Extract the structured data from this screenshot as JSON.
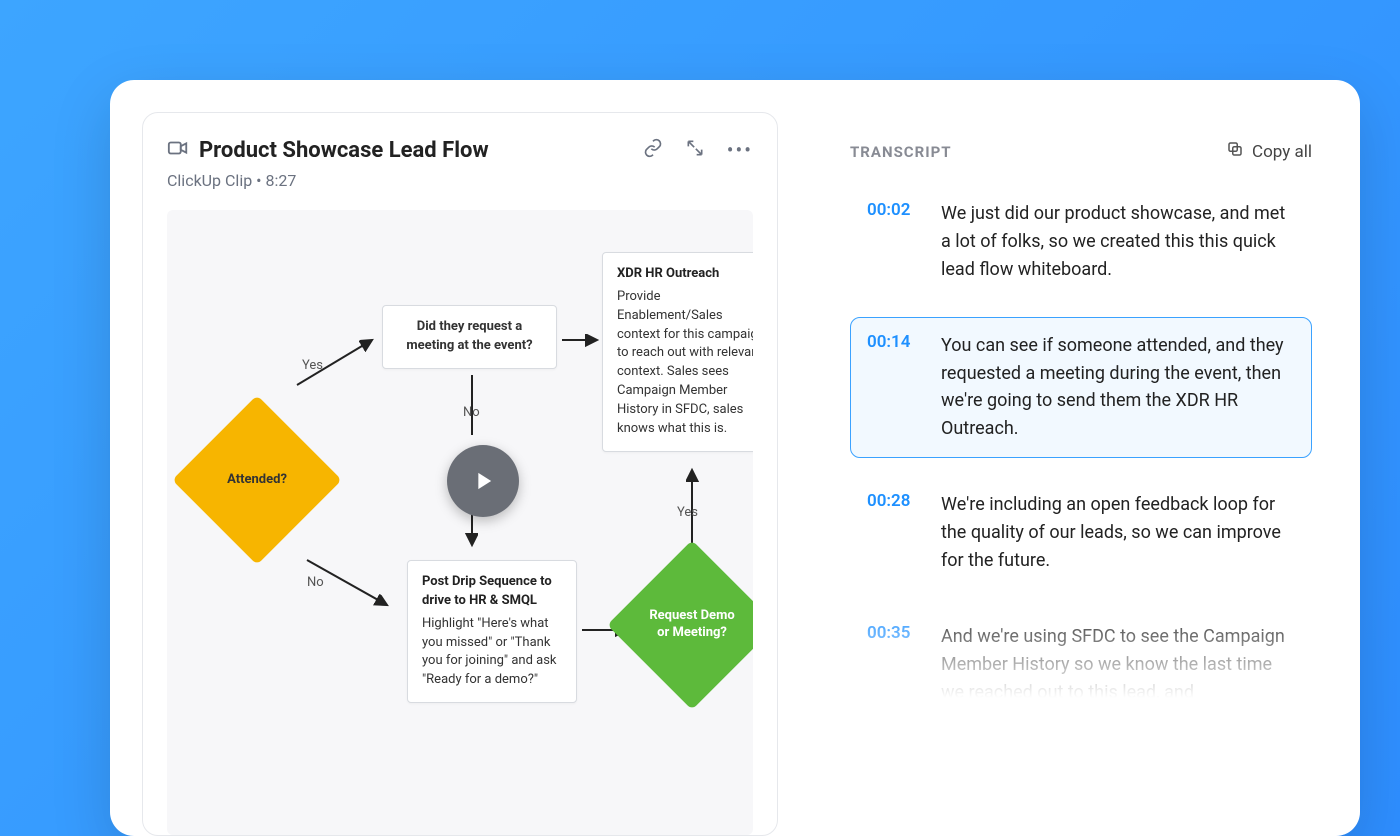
{
  "clip": {
    "title": "Product Showcase Lead Flow",
    "source": "ClickUp Clip",
    "duration": "8:27"
  },
  "flow": {
    "attended_label": "Attended?",
    "yes_label_top": "Yes",
    "no_label_bottom": "No",
    "no_label_mid": "No",
    "yes_label_right": "Yes",
    "meeting_question": "Did they request a meeting at the event?",
    "xdr_title": "XDR HR Outreach",
    "xdr_desc": "Provide Enablement/Sales context for this campaign to reach out with relevant context. Sales sees Campaign Member History in SFDC, sales knows what this is.",
    "drip_title": "Post Drip Sequence to drive to HR & SMQL",
    "drip_desc": "Highlight \"Here's what you missed\" or \"Thank you for joining\" and ask \"Ready for a demo?\"",
    "demo_label": "Request Demo or Meeting?"
  },
  "transcript": {
    "title": "Transcript",
    "copy_label": "Copy all",
    "rows": [
      {
        "time": "00:02",
        "text": "We just did our product showcase, and met a lot of folks, so we created this this quick lead flow whiteboard."
      },
      {
        "time": "00:14",
        "text": "You can see if someone attended, and they requested a meeting during the event, then we're going to send them the XDR HR Outreach."
      },
      {
        "time": "00:28",
        "text": "We're including an open feedback loop for the quality of our leads, so we can improve for the future."
      },
      {
        "time": "00:35",
        "text": "And we're using SFDC to see the Campaign Member History so we know the last time we reached out to this lead, and"
      }
    ],
    "active_index": 1
  }
}
